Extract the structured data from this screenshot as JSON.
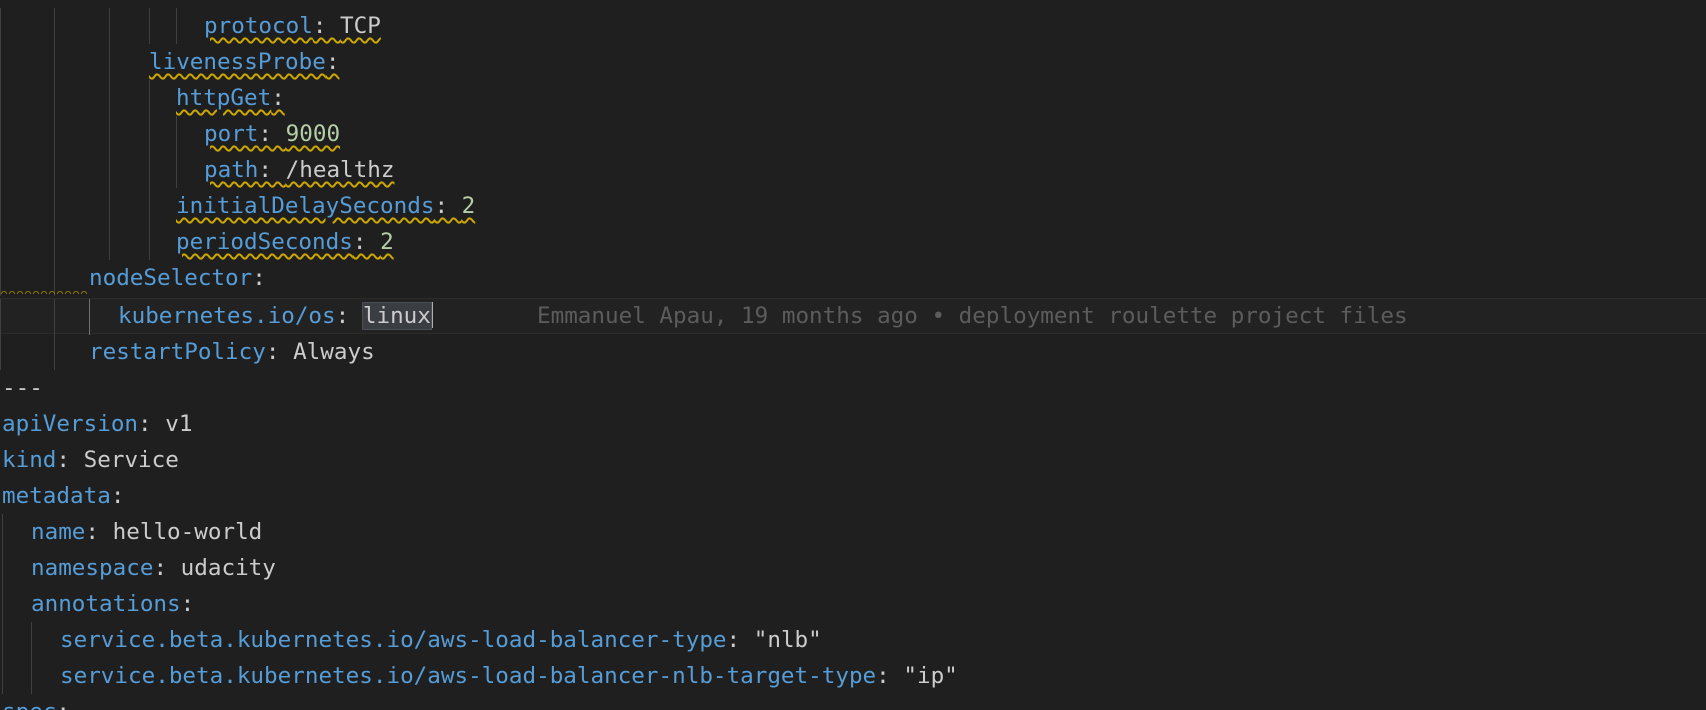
{
  "editor": {
    "blame": "Emmanuel Apau, 19 months ago • deployment roulette project files",
    "lines": [
      {
        "key": "protocol",
        "sep": ": ",
        "value": "TCP",
        "vtype": "str"
      },
      {
        "key": "livenessProbe",
        "sep": ":",
        "value": "",
        "vtype": "str"
      },
      {
        "key": "httpGet",
        "sep": ":",
        "value": "",
        "vtype": "str"
      },
      {
        "key": "port",
        "sep": ": ",
        "value": "9000",
        "vtype": "num"
      },
      {
        "key": "path",
        "sep": ": ",
        "value": "/healthz",
        "vtype": "str"
      },
      {
        "key": "initialDelaySeconds",
        "sep": ": ",
        "value": "2",
        "vtype": "num"
      },
      {
        "key": "periodSeconds",
        "sep": ": ",
        "value": "2",
        "vtype": "num"
      },
      {
        "key": "nodeSelector",
        "sep": ":",
        "value": "",
        "vtype": "str"
      },
      {
        "key": "kubernetes.io/os",
        "sep": ": ",
        "value": "linux",
        "vtype": "str"
      },
      {
        "key": "restartPolicy",
        "sep": ": ",
        "value": "Always",
        "vtype": "str"
      },
      {
        "key": "",
        "sep": "",
        "value": "---",
        "vtype": "str"
      },
      {
        "key": "apiVersion",
        "sep": ": ",
        "value": "v1",
        "vtype": "str"
      },
      {
        "key": "kind",
        "sep": ": ",
        "value": "Service",
        "vtype": "str"
      },
      {
        "key": "metadata",
        "sep": ":",
        "value": "",
        "vtype": "str"
      },
      {
        "key": "name",
        "sep": ": ",
        "value": "hello-world",
        "vtype": "str"
      },
      {
        "key": "namespace",
        "sep": ": ",
        "value": "udacity",
        "vtype": "str"
      },
      {
        "key": "annotations",
        "sep": ":",
        "value": "",
        "vtype": "str"
      },
      {
        "key": "service.beta.kubernetes.io/aws-load-balancer-type",
        "sep": ": ",
        "value": "\"nlb\"",
        "vtype": "str"
      },
      {
        "key": "service.beta.kubernetes.io/aws-load-balancer-nlb-target-type",
        "sep": ": ",
        "value": "\"ip\"",
        "vtype": "str"
      },
      {
        "key": "spec",
        "sep": ":",
        "value": "",
        "vtype": "str"
      }
    ]
  }
}
